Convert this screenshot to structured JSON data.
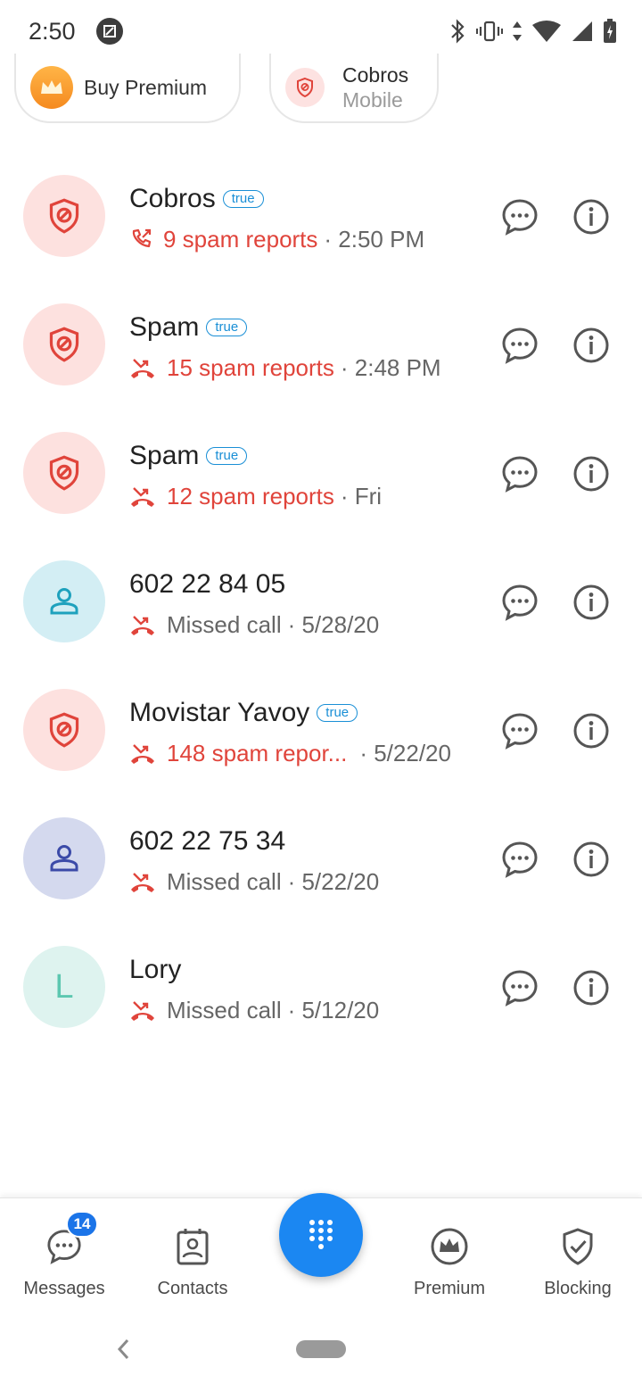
{
  "status_bar": {
    "time": "2:50"
  },
  "chips": {
    "premium": {
      "label": "Buy Premium"
    },
    "cobros": {
      "name": "Cobros",
      "sub": "Mobile"
    }
  },
  "calls": [
    {
      "name": "Cobros",
      "verified": "true",
      "detail": "9 spam reports",
      "time": "· 2:50 PM",
      "kind": "spam",
      "call_icon": "outgoing-call-icon"
    },
    {
      "name": "Spam",
      "verified": "true",
      "detail": "15 spam reports",
      "time": "· 2:48 PM",
      "kind": "spam",
      "call_icon": "missed-call-icon"
    },
    {
      "name": "Spam",
      "verified": "true",
      "detail": "12 spam reports",
      "time": "· Fri",
      "kind": "spam",
      "call_icon": "missed-call-icon"
    },
    {
      "name": "602 22 84 05",
      "detail": "Missed call",
      "time": "· 5/28/20",
      "kind": "contact",
      "call_icon": "missed-call-icon"
    },
    {
      "name": "Movistar Yavoy",
      "verified": "true",
      "detail": "148 spam repor...",
      "time": "· 5/22/20",
      "kind": "spam",
      "call_icon": "missed-call-icon"
    },
    {
      "name": "602 22 75 34",
      "detail": "Missed call",
      "time": "· 5/22/20",
      "kind": "contact",
      "call_icon": "missed-call-icon"
    },
    {
      "name": "Lory",
      "avatar_letter": "L",
      "detail": "Missed call",
      "time": "· 5/12/20",
      "kind": "contact",
      "call_icon": "missed-call-icon"
    }
  ],
  "bottom_nav": {
    "messages": {
      "label": "Messages",
      "badge": "14"
    },
    "contacts": {
      "label": "Contacts"
    },
    "premium": {
      "label": "Premium"
    },
    "blocking": {
      "label": "Blocking"
    }
  },
  "colors": {
    "spam_red": "#e0443b",
    "brand_blue": "#1b87f2",
    "badge_blue": "#1b74e8"
  }
}
